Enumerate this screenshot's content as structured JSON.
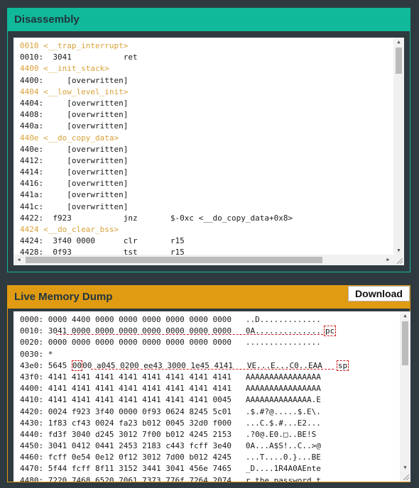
{
  "disassembly": {
    "title": "Disassembly",
    "lines": [
      {
        "text": "0010 <__trap_interrupt>",
        "kind": "label"
      },
      {
        "text": "0010:  3041           ret",
        "kind": "code"
      },
      {
        "text": "4400 <__init_stack>",
        "kind": "label"
      },
      {
        "text": "4400:     [overwritten]",
        "kind": "code"
      },
      {
        "text": "4404 <__low_level_init>",
        "kind": "label"
      },
      {
        "text": "4404:     [overwritten]",
        "kind": "code"
      },
      {
        "text": "4408:     [overwritten]",
        "kind": "code"
      },
      {
        "text": "440a:     [overwritten]",
        "kind": "code"
      },
      {
        "text": "440e <__do_copy_data>",
        "kind": "label"
      },
      {
        "text": "440e:     [overwritten]",
        "kind": "code"
      },
      {
        "text": "4412:     [overwritten]",
        "kind": "code"
      },
      {
        "text": "4414:     [overwritten]",
        "kind": "code"
      },
      {
        "text": "4416:     [overwritten]",
        "kind": "code"
      },
      {
        "text": "441a:     [overwritten]",
        "kind": "code"
      },
      {
        "text": "441c:     [overwritten]",
        "kind": "code"
      },
      {
        "text": "4422:  f923           jnz       $-0xc <__do_copy_data+0x8>",
        "kind": "code"
      },
      {
        "text": "4424 <__do_clear_bss>",
        "kind": "label"
      },
      {
        "text": "4424:  3f40 0000      clr       r15",
        "kind": "code"
      },
      {
        "text": "4428:  0f93           tst       r15",
        "kind": "code"
      }
    ]
  },
  "memory": {
    "title": "Live Memory Dump",
    "download_label": "Download",
    "rows": [
      {
        "text": "0000: 0000 4400 0000 0000 0000 0000 0000 0000   ..D.............",
        "marker": ""
      },
      {
        "text": "0010: 3041 0000 0000 0000 0000 0000 0000 0000   0A..............",
        "marker": "pc"
      },
      {
        "text": "0020: 0000 0000 0000 0000 0000 0000 0000 0000   ................",
        "marker": ""
      },
      {
        "text": "0030: *",
        "marker": ""
      },
      {
        "text": "43e0: 5645 0000 a045 0200 ee43 3000 1e45 4141   VE...E...C0..EAA",
        "marker": "sp"
      },
      {
        "text": "43f0: 4141 4141 4141 4141 4141 4141 4141 4141   AAAAAAAAAAAAAAAA",
        "marker": ""
      },
      {
        "text": "4400: 4141 4141 4141 4141 4141 4141 4141 4141   AAAAAAAAAAAAAAAA",
        "marker": ""
      },
      {
        "text": "4410: 4141 4141 4141 4141 4141 4141 4141 0045   AAAAAAAAAAAAAA.E",
        "marker": ""
      },
      {
        "text": "4420: 0024 f923 3f40 0000 0f93 0624 8245 5c01   .$.#?@.....$.E\\.",
        "marker": ""
      },
      {
        "text": "4430: 1f83 cf43 0024 fa23 b012 0045 32d0 f000   ...C.$.#...E2...",
        "marker": ""
      },
      {
        "text": "4440: fd3f 3040 d245 3012 7f00 b012 4245 2153   .?0@.E0.□..BE!S",
        "marker": ""
      },
      {
        "text": "4450: 3041 0412 0441 2453 2183 c443 fcff 3e40   0A...A$S!..C..>@",
        "marker": ""
      },
      {
        "text": "4460: fcff 0e54 0e12 0f12 3012 7d00 b012 4245   ...T....0.}...BE",
        "marker": ""
      },
      {
        "text": "4470: 5f44 fcff 8f11 3152 3441 3041 456e 7465   _D....1R4A0AEnte",
        "marker": ""
      },
      {
        "text": "4480: 7220 7468 6520 7061 7373 776f 7264 2074   r the password t",
        "marker": ""
      }
    ]
  }
}
